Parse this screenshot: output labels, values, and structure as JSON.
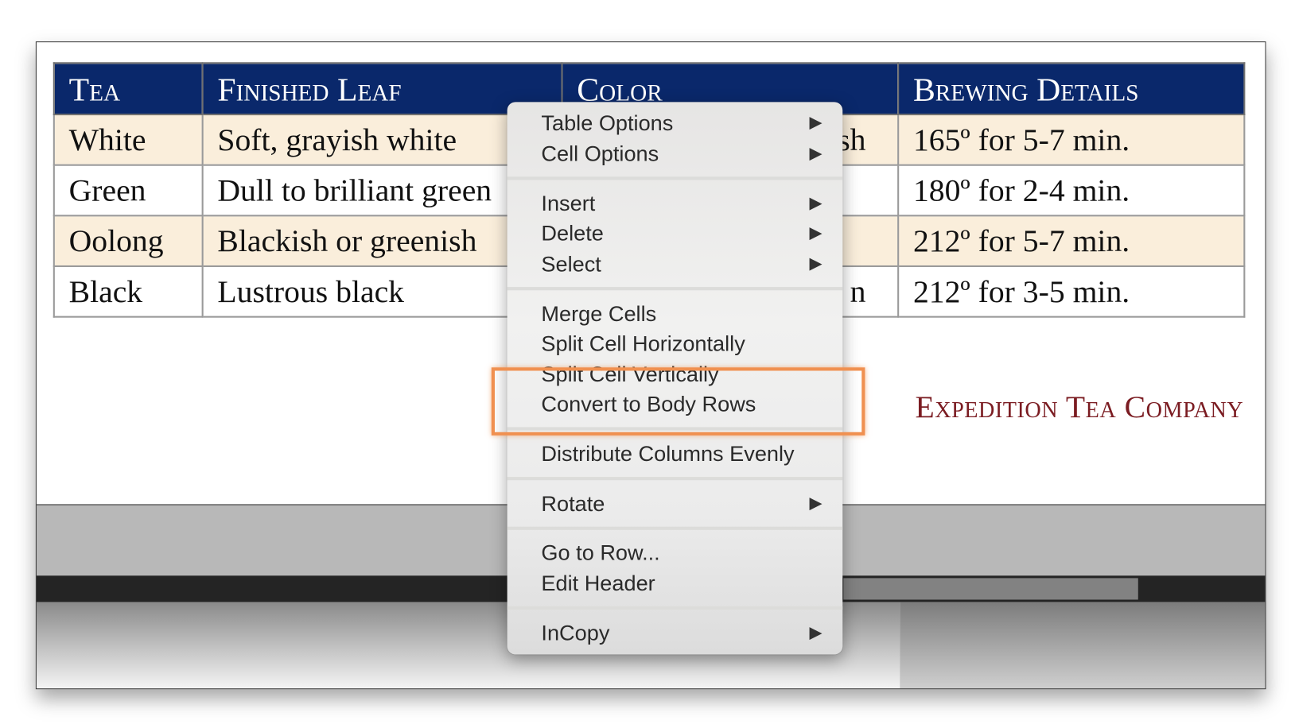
{
  "table": {
    "headers": [
      "Tea",
      "Finished Leaf",
      "Color",
      "Brewing Details"
    ],
    "rows": [
      [
        "White",
        "Soft, grayish white",
        "sh",
        "165º for 5-7 min."
      ],
      [
        "Green",
        "Dull to brilliant green",
        "",
        "180º for 2-4 min."
      ],
      [
        "Oolong",
        "Blackish or greenish",
        "",
        "212º for 5-7 min."
      ],
      [
        "Black",
        "Lustrous black",
        "n",
        "212º for 3-5 min."
      ]
    ],
    "header_bg": "#0a286b",
    "alt_row_bg": "#faeedb"
  },
  "company": "Expedition Tea Company",
  "context_menu": {
    "items": [
      {
        "label": "Table Options",
        "submenu": true
      },
      {
        "label": "Cell Options",
        "submenu": true
      },
      {
        "label": "Insert",
        "submenu": true
      },
      {
        "label": "Delete",
        "submenu": true
      },
      {
        "label": "Select",
        "submenu": true
      },
      {
        "label": "Merge Cells"
      },
      {
        "label": "Split Cell Horizontally"
      },
      {
        "label": "Split Cell Vertically"
      },
      {
        "label": "Convert to Body Rows",
        "highlighted": true
      },
      {
        "label": "Distribute Columns Evenly"
      },
      {
        "label": "Rotate",
        "submenu": true
      },
      {
        "label": "Go to Row..."
      },
      {
        "label": "Edit Header"
      },
      {
        "label": "InCopy",
        "submenu": true
      }
    ],
    "submenu_icon": "▶",
    "highlight_color": "#f09050"
  }
}
